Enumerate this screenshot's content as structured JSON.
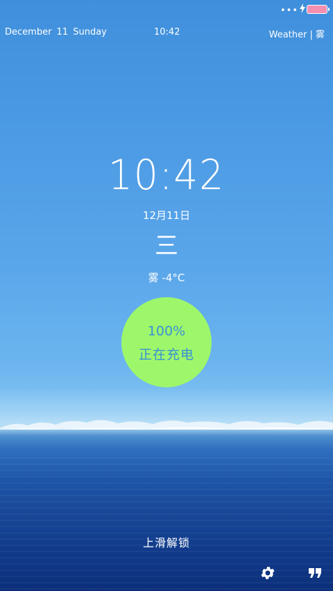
{
  "status_bar": {
    "dots": "•••"
  },
  "header": {
    "date": "December  11  Sunday",
    "time": "10:42",
    "weather": "Weather  |  雾"
  },
  "lockscreen": {
    "clock": "10:42",
    "date_cn": "12月11日",
    "weekday": "三",
    "weather": "雾 -4°C"
  },
  "charging": {
    "percent": "100%",
    "status": "正在充电",
    "level": 1.0
  },
  "bottom": {
    "unlock_hint": "上滑解锁"
  },
  "icons": {
    "settings": "gear-icon",
    "quote": "quote-icon",
    "charging": "lightning-icon",
    "battery": "battery-icon"
  },
  "colors": {
    "charge_circle": "#9ef76a",
    "charge_text": "#3a8fd6",
    "battery_fill": "#f58fb0"
  }
}
